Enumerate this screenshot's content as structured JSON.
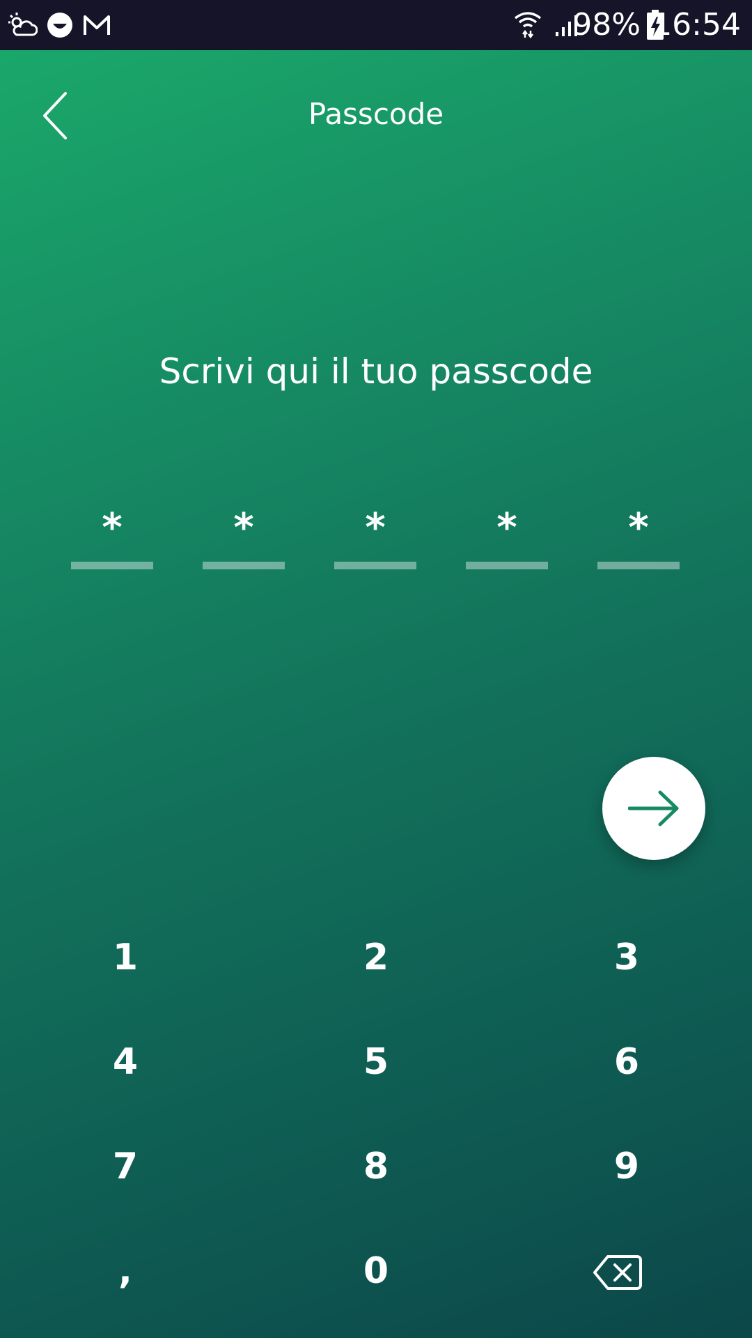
{
  "status_bar": {
    "battery_percent": "98%",
    "time": "16:54",
    "left_icons": [
      "weather-icon",
      "app-icon",
      "gmail-icon"
    ],
    "right_icons": [
      "wifi-icon",
      "signal-icon",
      "battery-charging-icon"
    ]
  },
  "header": {
    "title": "Passcode",
    "back_icon": "chevron-left-icon"
  },
  "prompt": "Scrivi qui il tuo passcode",
  "passcode": {
    "slots": [
      "*",
      "*",
      "*",
      "*",
      "*"
    ]
  },
  "next_button": {
    "icon": "arrow-right-icon"
  },
  "keypad": {
    "keys": [
      "1",
      "2",
      "3",
      "4",
      "5",
      "6",
      "7",
      "8",
      "9",
      ",",
      "0"
    ],
    "backspace_icon": "backspace-icon"
  },
  "colors": {
    "status_bar": "#151428",
    "gradient_start": "#1bab6b",
    "gradient_end": "#0c4749",
    "fab_arrow": "#168a63"
  }
}
